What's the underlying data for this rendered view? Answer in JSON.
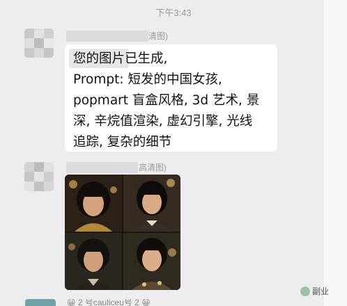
{
  "timestamp": "下午3:43",
  "message1": {
    "name_suffix": "清图)",
    "text": "您的图片已生成,\nPrompt: 短发的中国女孩,\npopmart 盲盒风格, 3d 艺术, 景\n深, 辛烷值渲染, 虚幻引擎, 光线\n追踪, 复杂的细节"
  },
  "message2": {
    "name_suffix": "高清图)"
  },
  "watermark": "副业",
  "bottom_preview": "😀 2 号cauliceu号 2 😀"
}
